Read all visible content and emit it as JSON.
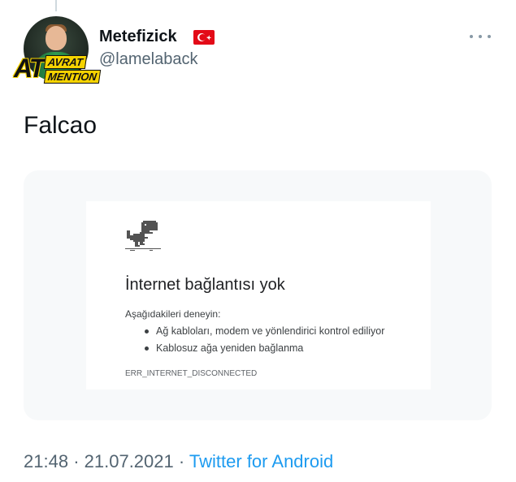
{
  "tweet": {
    "author": {
      "display_name": "Metefizick",
      "handle": "@lamelaback",
      "flag_icon": "turkey-flag-icon",
      "avatar_badge": {
        "big": "AT",
        "top": "AVRAT",
        "bottom": "MENTION"
      }
    },
    "text": "Falcao",
    "more_icon": "more-horizontal-icon",
    "media": {
      "title": "İnternet bağlantısı yok",
      "subtitle": "Aşağıdakileri deneyin:",
      "items": [
        "Ağ kabloları, modem ve yönlendirici kontrol ediliyor",
        "Kablosuz ağa yeniden bağlanma"
      ],
      "error_code": "ERR_INTERNET_DISCONNECTED",
      "icon": "dinosaur-icon"
    },
    "time": "21:48",
    "date": "21.07.2021",
    "separator": "·",
    "source": "Twitter for Android"
  },
  "colors": {
    "link": "#1d9bf0",
    "secondary_text": "#536471",
    "card_background": "#f7f9fa",
    "flag_red": "#e30a17",
    "badge_yellow": "#f6d300"
  }
}
